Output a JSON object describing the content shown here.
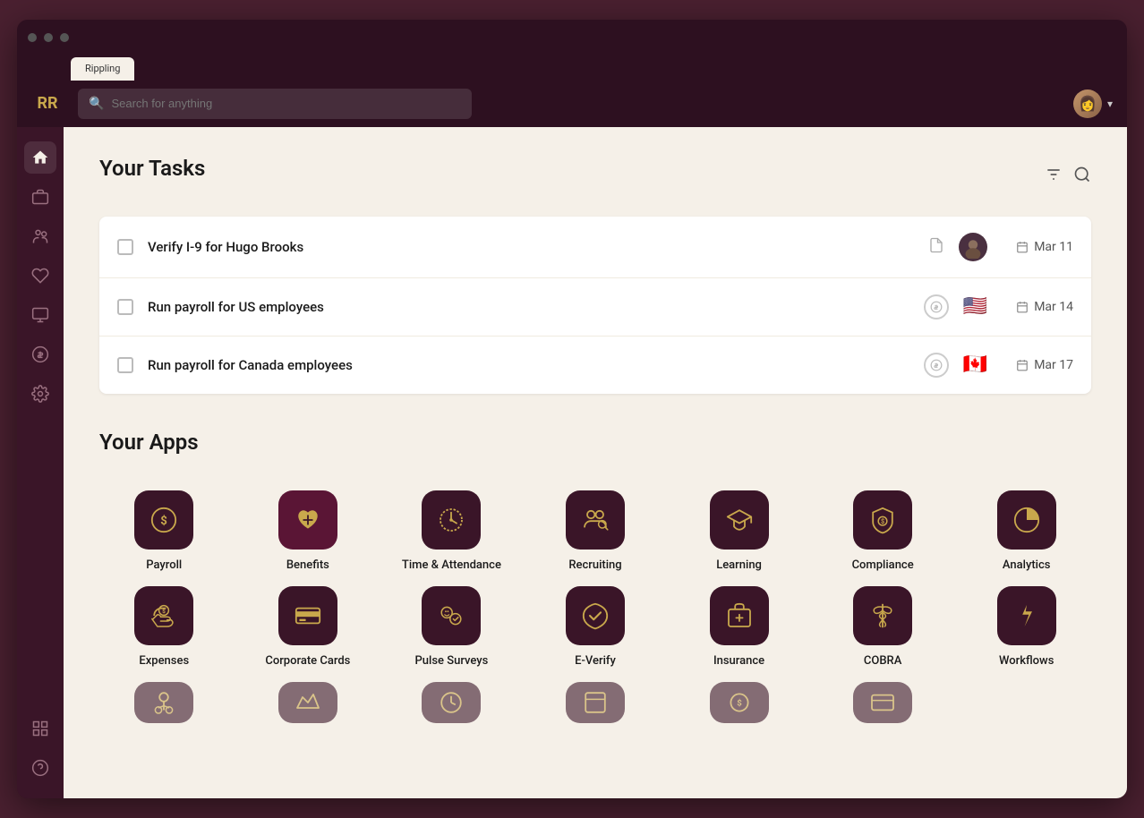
{
  "browser": {
    "tab_label": "Rippling"
  },
  "topbar": {
    "logo_text": "RR",
    "search_placeholder": "Search for anything",
    "user_chevron": "▾"
  },
  "sidebar": {
    "items": [
      {
        "name": "home",
        "icon": "🏠",
        "active": true
      },
      {
        "name": "briefcase",
        "icon": "💼",
        "active": false
      },
      {
        "name": "people",
        "icon": "👥",
        "active": false
      },
      {
        "name": "heart",
        "icon": "♡",
        "active": false
      },
      {
        "name": "monitor",
        "icon": "🖥",
        "active": false
      },
      {
        "name": "dollar",
        "icon": "$",
        "active": false
      },
      {
        "name": "settings",
        "icon": "⚙",
        "active": false
      },
      {
        "name": "widgets",
        "icon": "⊞",
        "active": false
      },
      {
        "name": "help",
        "icon": "?",
        "active": false
      }
    ]
  },
  "tasks": {
    "section_title": "Your Tasks",
    "items": [
      {
        "label": "Verify I-9 for Hugo Brooks",
        "date": "Mar 11",
        "has_doc_icon": true,
        "has_person_avatar": true,
        "flag": null
      },
      {
        "label": "Run payroll for US employees",
        "date": "Mar 14",
        "has_doc_icon": false,
        "has_person_avatar": false,
        "flag": "🇺🇸"
      },
      {
        "label": "Run payroll for Canada employees",
        "date": "Mar 17",
        "has_doc_icon": false,
        "has_person_avatar": false,
        "flag": "🇨🇦"
      }
    ]
  },
  "apps": {
    "section_title": "Your Apps",
    "rows": [
      [
        {
          "id": "payroll",
          "label": "Payroll",
          "icon_type": "dollar-circle"
        },
        {
          "id": "benefits",
          "label": "Benefits",
          "icon_type": "heart-plus"
        },
        {
          "id": "time-attendance",
          "label": "Time & Attendance",
          "icon_type": "clock-circle"
        },
        {
          "id": "recruiting",
          "label": "Recruiting",
          "icon_type": "people-search"
        },
        {
          "id": "learning",
          "label": "Learning",
          "icon_type": "graduation"
        },
        {
          "id": "compliance",
          "label": "Compliance",
          "icon_type": "shield-dollar"
        },
        {
          "id": "analytics",
          "label": "Analytics",
          "icon_type": "pie-chart"
        }
      ],
      [
        {
          "id": "expenses",
          "label": "Expenses",
          "icon_type": "hand-dollar"
        },
        {
          "id": "corporate-cards",
          "label": "Corporate Cards",
          "icon_type": "credit-card"
        },
        {
          "id": "pulse-surveys",
          "label": "Pulse Surveys",
          "icon_type": "face-check"
        },
        {
          "id": "e-verify",
          "label": "E-Verify",
          "icon_type": "badge-check"
        },
        {
          "id": "insurance",
          "label": "Insurance",
          "icon_type": "briefcase-plus"
        },
        {
          "id": "cobra",
          "label": "COBRA",
          "icon_type": "caduceus"
        },
        {
          "id": "workflows",
          "label": "Workflows",
          "icon_type": "lightning"
        }
      ]
    ]
  }
}
